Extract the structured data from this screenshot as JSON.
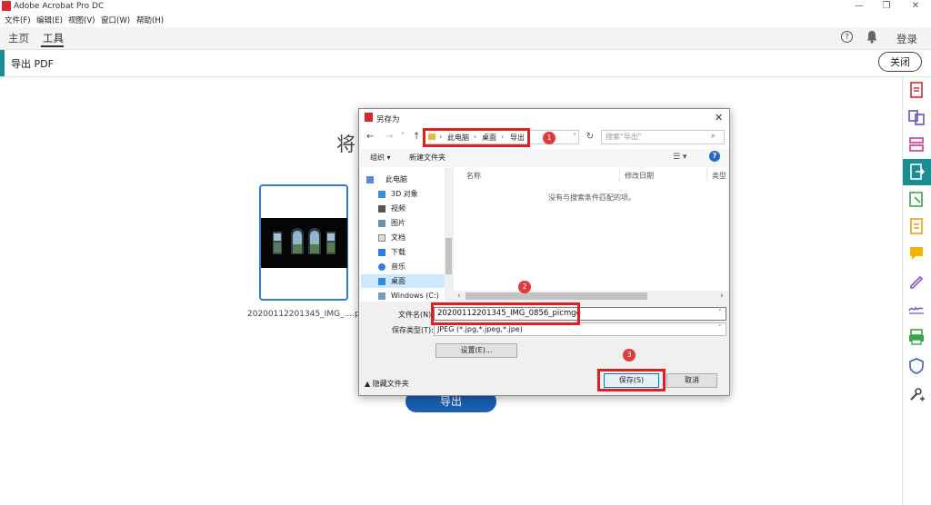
{
  "app": {
    "title": "Adobe Acrobat Pro DC"
  },
  "window_controls": {
    "minimize": "—",
    "maximize": "❐",
    "close": "✕"
  },
  "menu": {
    "items": [
      "文件(F)",
      "编辑(E)",
      "视图(V)",
      "窗口(W)",
      "帮助(H)"
    ]
  },
  "nav": {
    "home": "主页",
    "tools": "工具",
    "help": "?",
    "login": "登录"
  },
  "export_header": {
    "title": "导出 PDF",
    "close": "关闭"
  },
  "main": {
    "heading": "将",
    "thumbnail_caption": "20200112201345_IMG_....pdf",
    "export_button": "导出"
  },
  "dialog": {
    "title": "另存为",
    "close": "✕",
    "nav_back": "←",
    "nav_forward": "→",
    "nav_recent": "˅",
    "nav_up": "↑",
    "breadcrumb": [
      "此电脑",
      "桌面",
      "导出"
    ],
    "breadcrumb_sep": "›",
    "addr_dropdown": "˅",
    "refresh": "↻",
    "search_placeholder": "搜索\"导出\"",
    "search_icon": "⌕",
    "organize": "组织 ▾",
    "new_folder": "新建文件夹",
    "view": "☰ ▾",
    "help": "?",
    "nav_pane": [
      "此电脑",
      "3D 对象",
      "视频",
      "图片",
      "文档",
      "下载",
      "音乐",
      "桌面",
      "Windows (C:)"
    ],
    "columns": {
      "name": "名称",
      "modified": "修改日期",
      "type": "类型"
    },
    "empty_message": "没有与搜索条件匹配的项。",
    "scroll_left": "‹",
    "scroll_right": "›",
    "filename_label": "文件名(N):",
    "filename_value": "20200112201345_IMG_0856_picmge",
    "filetype_label": "保存类型(T):",
    "filetype_value": "JPEG (*.jpg,*.jpeg,*.jpe)",
    "dropdown_arrow": "˅",
    "settings": "设置(E)...",
    "hide_folders": "▲  隐藏文件夹",
    "save": "保存(S)",
    "cancel": "取消"
  },
  "annotations": [
    "1",
    "2",
    "3"
  ],
  "colors": {
    "accent": "#1a8e92",
    "export_button": "#1a5fb0",
    "annotation_red": "#e02020",
    "thumb_border": "#2d7fd1"
  }
}
